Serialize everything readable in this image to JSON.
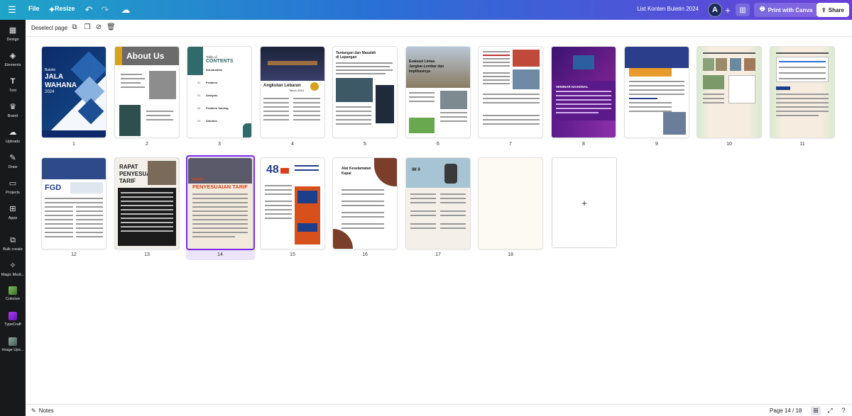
{
  "topbar": {
    "menu_icon": "hamburger-icon",
    "file_label": "File",
    "resize_label": "Resize",
    "doc_title": "List Konten Buletin 2024",
    "avatar_letter": "A",
    "print_label": "Print with Canva",
    "share_label": "Share"
  },
  "sidebar": {
    "items": [
      {
        "label": "Design",
        "icon": "layout-icon"
      },
      {
        "label": "Elements",
        "icon": "shapes-icon"
      },
      {
        "label": "Text",
        "icon": "text-icon"
      },
      {
        "label": "Brand",
        "icon": "brand-icon"
      },
      {
        "label": "Uploads",
        "icon": "upload-icon"
      },
      {
        "label": "Draw",
        "icon": "pen-icon"
      },
      {
        "label": "Projects",
        "icon": "folder-icon"
      },
      {
        "label": "Apps",
        "icon": "apps-icon"
      },
      {
        "label": "Bulk create",
        "icon": "bulk-create-icon"
      },
      {
        "label": "Magic Medi...",
        "icon": "magic-media-icon"
      },
      {
        "label": "Colorize",
        "icon": "colorize-icon"
      },
      {
        "label": "TypeCraft",
        "icon": "typecraft-icon"
      },
      {
        "label": "Image Ups...",
        "icon": "image-upscaler-icon"
      }
    ]
  },
  "toolbar": {
    "deselect_label": "Deselect page"
  },
  "pages": {
    "numbers": [
      "1",
      "2",
      "3",
      "4",
      "5",
      "6",
      "7",
      "8",
      "9",
      "10",
      "11",
      "12",
      "13",
      "14",
      "15",
      "16",
      "17",
      "18"
    ],
    "selected": "14",
    "p1": {
      "line1": "Buletin",
      "line2": "JALA",
      "line3": "WAHANA",
      "line4": "2024"
    },
    "p2": {
      "title": "About Us"
    },
    "p3": {
      "title1": "Table of",
      "title2": "CONTENTS",
      "items": [
        "Introduction",
        "Problem",
        "Analysis",
        "Problem Solving",
        "Solution"
      ],
      "nums": [
        "01",
        "02",
        "03",
        "04",
        "05"
      ]
    },
    "p4": {
      "title": "Angkutan Lebaran",
      "sub": "Tahun 2024"
    },
    "p5": {
      "title1": "Tantangan dan Masalah",
      "title2": "di Lapangan"
    },
    "p6": {
      "title1": "Evaluasi Lintas",
      "title2": "Jangkar-Lembar dan",
      "title3": "Implikasinya"
    },
    "p8": {
      "title": "SEMINAR NASIONAL"
    },
    "p12": {
      "title": "FGD"
    },
    "p13": {
      "title1": "RAPAT",
      "title2": "PENYESUAIAN",
      "title3": "TARIF"
    },
    "p14": {
      "title1": "RAPAT",
      "title2": "PENYESUAIAN TARIF"
    },
    "p15": {
      "badge": "48"
    },
    "p16": {
      "title1": "Alat Keselamatan",
      "title2": "Kapal"
    },
    "p17": {
      "title": "IM 9"
    }
  },
  "bottom": {
    "notes_label": "Notes",
    "page_indicator": "Page 14 / 18"
  }
}
